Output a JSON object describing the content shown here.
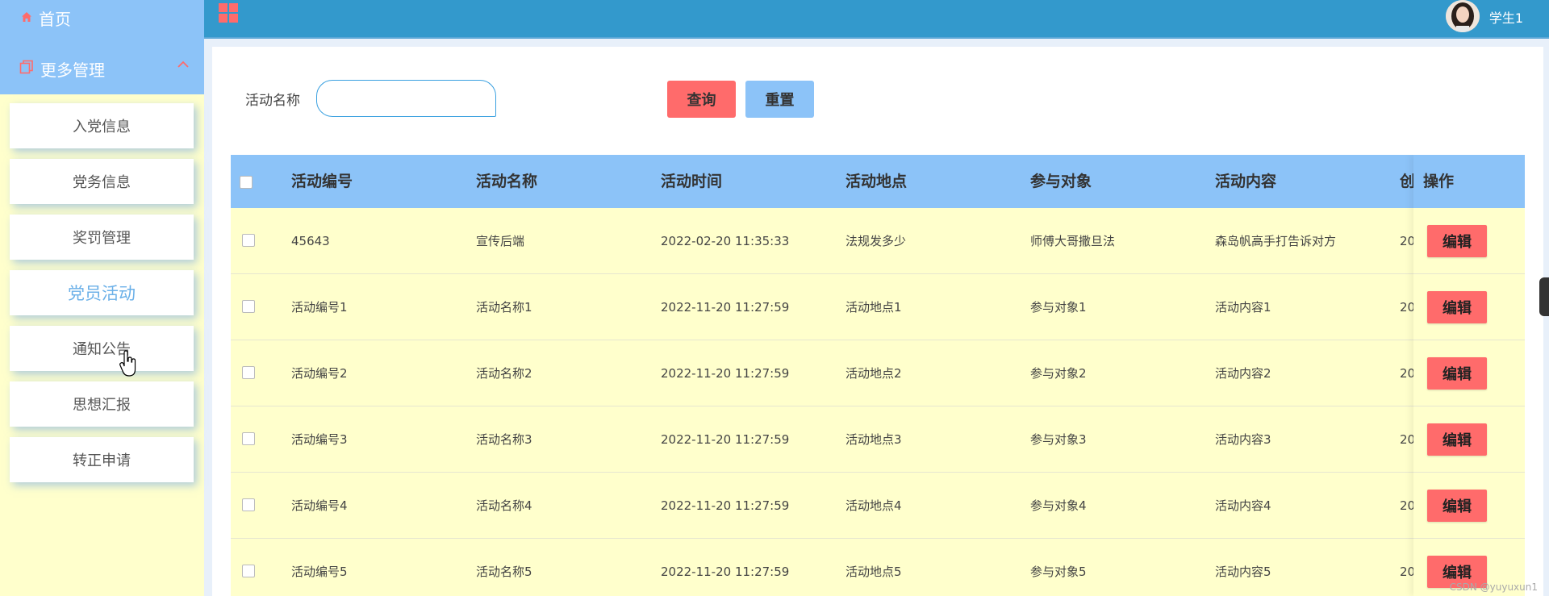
{
  "sidebar": {
    "home_label": "首页",
    "more_label": "更多管理",
    "items": [
      {
        "label": "入党信息",
        "active": false
      },
      {
        "label": "党务信息",
        "active": false
      },
      {
        "label": "奖罚管理",
        "active": false
      },
      {
        "label": "党员活动",
        "active": true
      },
      {
        "label": "通知公告",
        "active": false
      },
      {
        "label": "思想汇报",
        "active": false
      },
      {
        "label": "转正申请",
        "active": false
      }
    ]
  },
  "header": {
    "menu_icon": "grid-icon",
    "user_name": "学生1",
    "accent_color": "#3399cc"
  },
  "search": {
    "label": "活动名称",
    "value": "",
    "query_label": "查询",
    "reset_label": "重置"
  },
  "table": {
    "columns": [
      "活动编号",
      "活动名称",
      "活动时间",
      "活动地点",
      "参与对象",
      "活动内容",
      "创",
      "操作"
    ],
    "rows": [
      {
        "no": "45643",
        "name": "宣传后端",
        "time": "2022-02-20 11:35:33",
        "place": "法规发多少",
        "target": "师傅大哥撒旦法",
        "content": "森岛帆高手打告诉对方",
        "created": "20"
      },
      {
        "no": "活动编号1",
        "name": "活动名称1",
        "time": "2022-11-20 11:27:59",
        "place": "活动地点1",
        "target": "参与对象1",
        "content": "活动内容1",
        "created": "20"
      },
      {
        "no": "活动编号2",
        "name": "活动名称2",
        "time": "2022-11-20 11:27:59",
        "place": "活动地点2",
        "target": "参与对象2",
        "content": "活动内容2",
        "created": "20"
      },
      {
        "no": "活动编号3",
        "name": "活动名称3",
        "time": "2022-11-20 11:27:59",
        "place": "活动地点3",
        "target": "参与对象3",
        "content": "活动内容3",
        "created": "20"
      },
      {
        "no": "活动编号4",
        "name": "活动名称4",
        "time": "2022-11-20 11:27:59",
        "place": "活动地点4",
        "target": "参与对象4",
        "content": "活动内容4",
        "created": "20"
      },
      {
        "no": "活动编号5",
        "name": "活动名称5",
        "time": "2022-11-20 11:27:59",
        "place": "活动地点5",
        "target": "参与对象5",
        "content": "活动内容5",
        "created": "20"
      }
    ],
    "edit_label": "编辑"
  },
  "watermark": "CSDN @yuyuxun1"
}
